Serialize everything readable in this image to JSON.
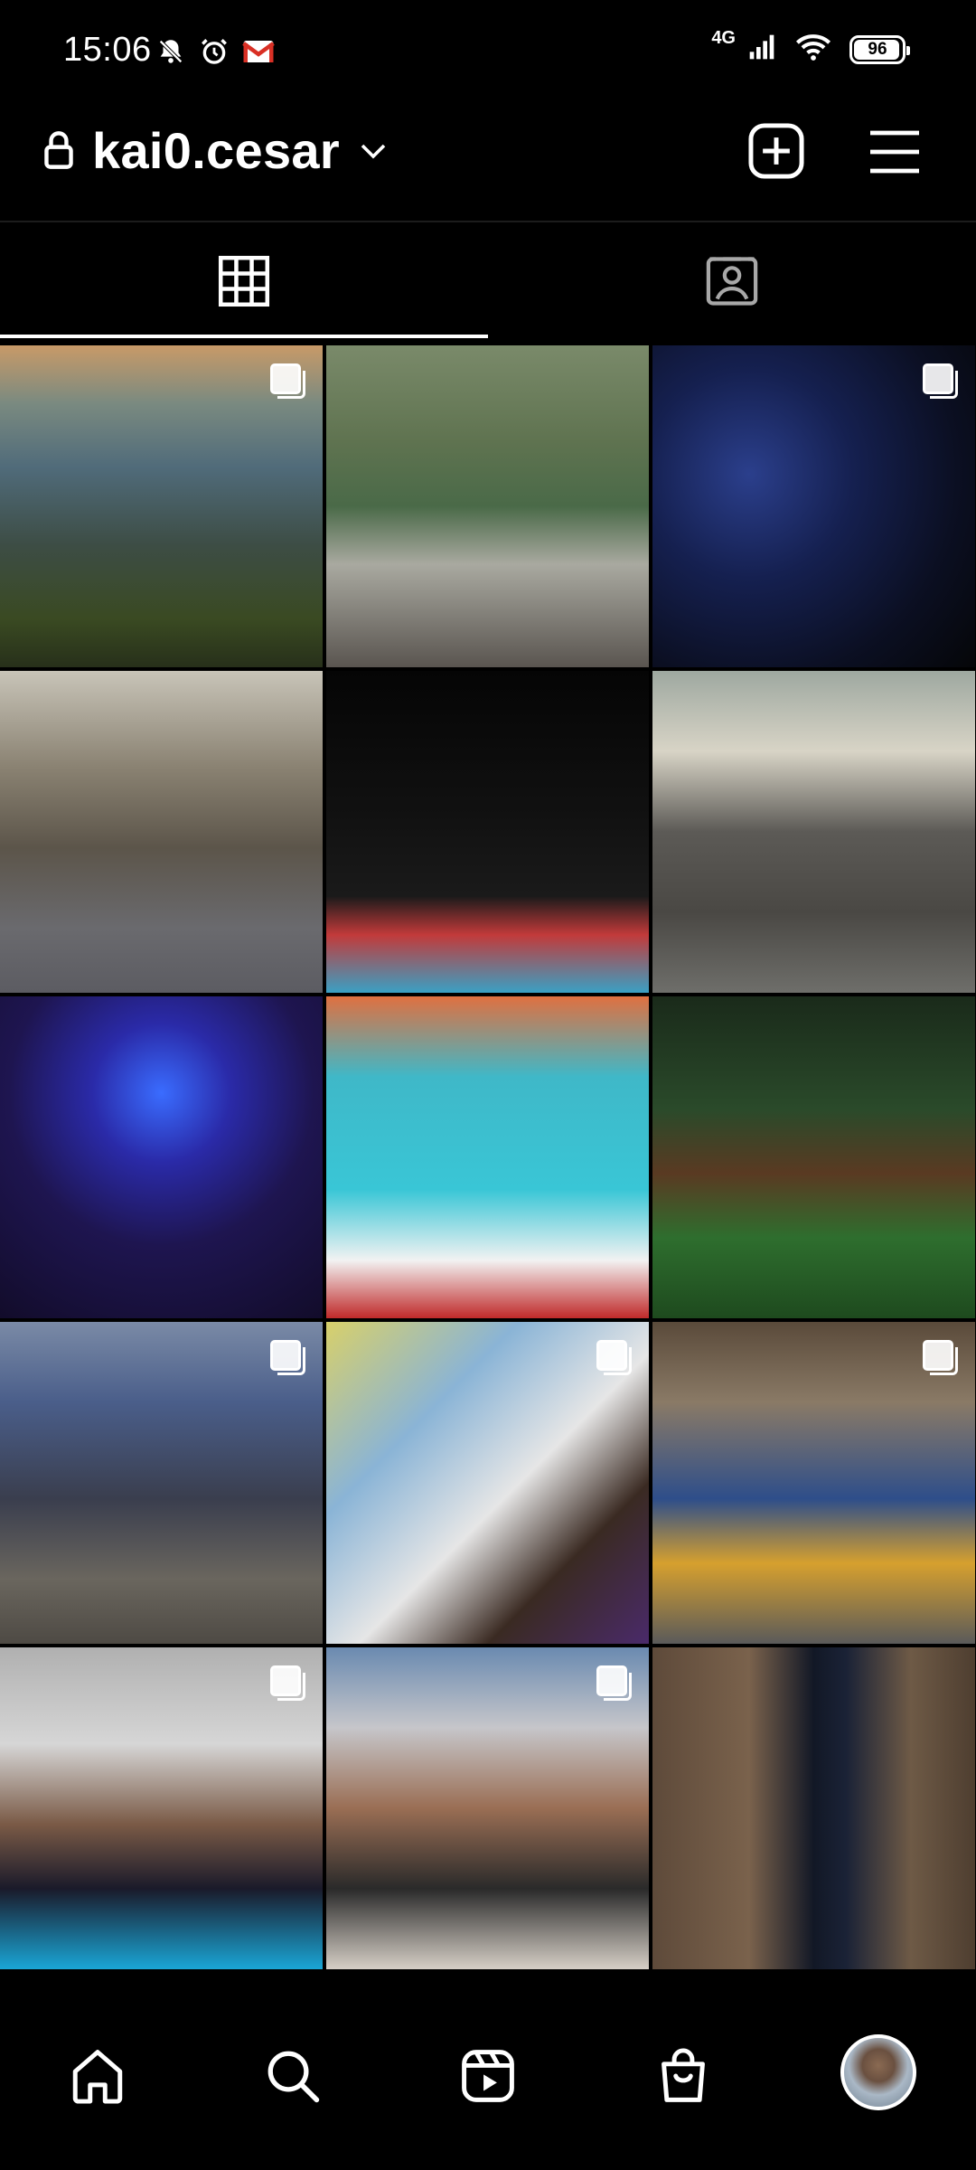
{
  "status_bar": {
    "time": "15:06",
    "network": "4G",
    "battery": "96",
    "battery_level": 0.96,
    "icons_left": [
      "notifications-muted-icon",
      "alarm-icon",
      "gmail-icon"
    ],
    "icons_right": [
      "cellular-signal-icon",
      "wifi-icon",
      "battery-icon"
    ]
  },
  "header": {
    "username": "kai0.cesar",
    "lock_icon": "lock-icon",
    "dropdown_icon": "chevron-down-icon",
    "new_post_icon": "plus-square-icon",
    "menu_icon": "hamburger-menu-icon"
  },
  "tabs": [
    {
      "name": "posts-grid",
      "icon": "grid-icon",
      "active": true
    },
    {
      "name": "tagged",
      "icon": "tagged-user-icon",
      "active": false
    }
  ],
  "grid": {
    "posts": [
      {
        "id": 1,
        "carousel": true
      },
      {
        "id": 2,
        "carousel": false
      },
      {
        "id": 3,
        "carousel": true
      },
      {
        "id": 4,
        "carousel": false
      },
      {
        "id": 5,
        "carousel": false
      },
      {
        "id": 6,
        "carousel": false
      },
      {
        "id": 7,
        "carousel": false
      },
      {
        "id": 8,
        "carousel": false
      },
      {
        "id": 9,
        "carousel": false
      },
      {
        "id": 10,
        "carousel": true
      },
      {
        "id": 11,
        "carousel": true
      },
      {
        "id": 12,
        "carousel": true
      },
      {
        "id": 13,
        "carousel": true
      },
      {
        "id": 14,
        "carousel": true
      },
      {
        "id": 15,
        "carousel": false
      }
    ]
  },
  "bottom_nav": {
    "items": [
      "home-icon",
      "search-icon",
      "reels-icon",
      "shop-icon",
      "profile-avatar"
    ]
  },
  "colors": {
    "background": "#000000",
    "foreground": "#ffffff",
    "divider": "#1c1c1c"
  }
}
